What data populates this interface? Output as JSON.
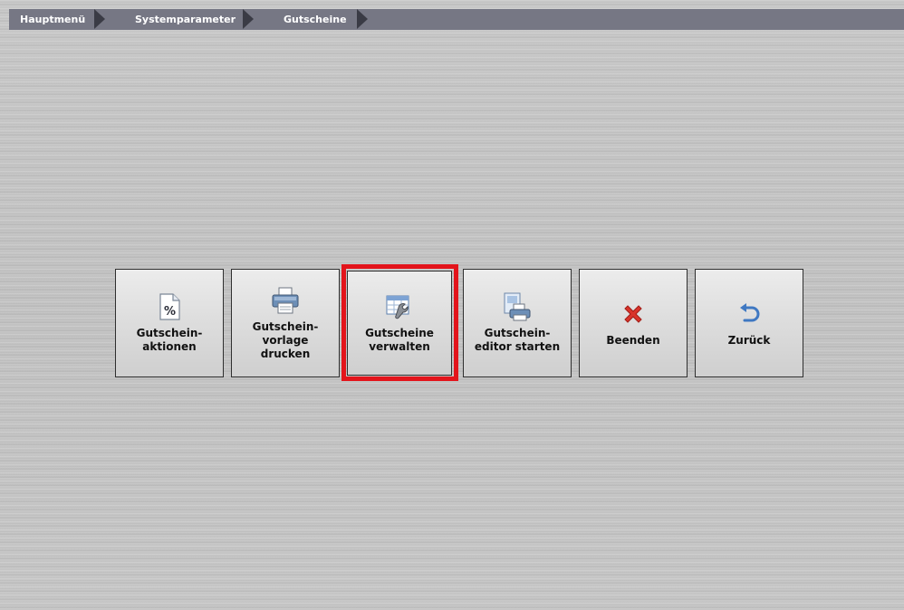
{
  "breadcrumb": {
    "items": [
      "Hauptmenü",
      "Systemparameter",
      "Gutscheine"
    ]
  },
  "buttons": [
    {
      "label": "Gutschein-\naktionen",
      "icon": "percent-document-icon"
    },
    {
      "label": "Gutschein-\nvorlage\ndrucken",
      "icon": "printer-icon"
    },
    {
      "label": "Gutscheine\nverwalten",
      "icon": "table-wrench-icon"
    },
    {
      "label": "Gutschein-\neditor starten",
      "icon": "document-printer-icon"
    },
    {
      "label": "Beenden",
      "icon": "close-icon"
    },
    {
      "label": "Zurück",
      "icon": "undo-arrow-icon"
    }
  ],
  "colors": {
    "breadcrumb_bg": "#767784",
    "breadcrumb_arrow": "#3a3b45",
    "highlight": "#e3141b",
    "close_icon": "#d9342b",
    "back_icon": "#3f78c2"
  }
}
